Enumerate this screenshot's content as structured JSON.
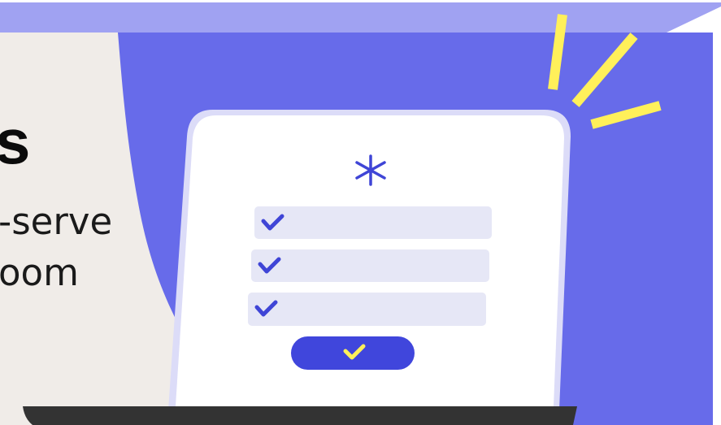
{
  "hero": {
    "headline_fragment": "s",
    "subtext_lines": [
      "-serve",
      "oom"
    ]
  },
  "form_card": {
    "asterisk_icon": "asterisk-icon",
    "rows": [
      {
        "icon": "check-icon"
      },
      {
        "icon": "check-icon"
      },
      {
        "icon": "check-icon"
      }
    ],
    "submit_icon": "check-icon"
  },
  "colors": {
    "background_left": "#f0ece8",
    "accent_purple": "#676bea",
    "light_purple": "#a0a2f2",
    "card_white": "#ffffff",
    "card_outline": "#dcdcf8",
    "row_fill": "#e6e7f6",
    "check_blue": "#3f45d6",
    "button_blue": "#4046dc",
    "spark_yellow": "#fff05a",
    "laptop_base": "#333333"
  }
}
